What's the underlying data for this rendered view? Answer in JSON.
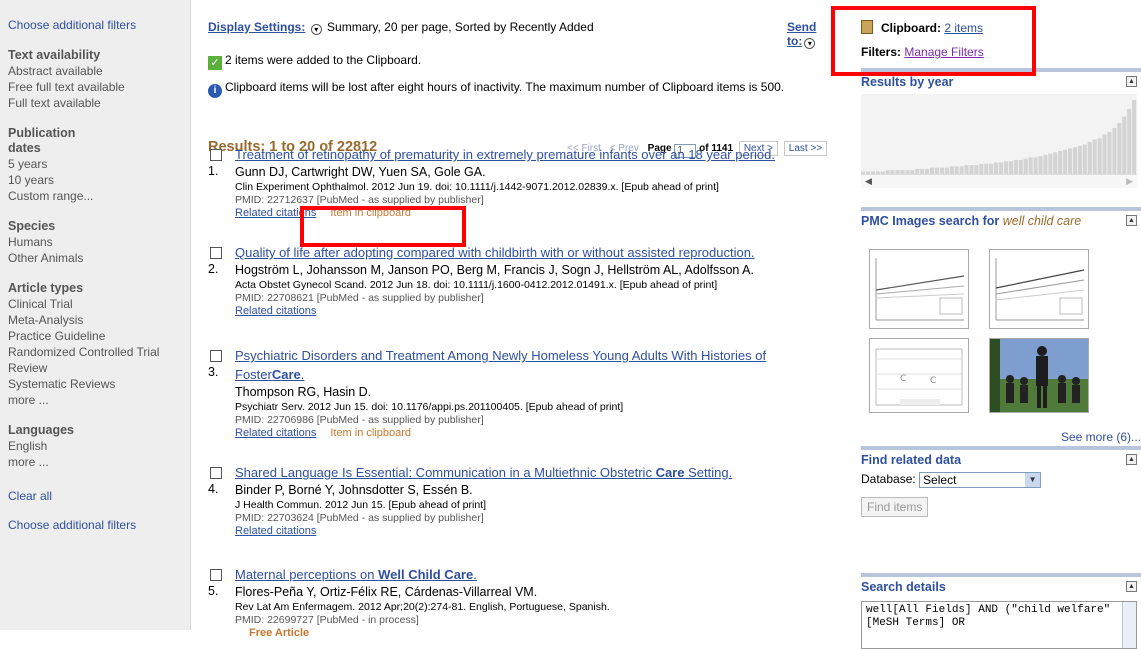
{
  "left": {
    "choose_filters_top": "Choose additional filters",
    "groups": [
      {
        "title": "Text availability",
        "items": [
          "Abstract available",
          "Free full text available",
          "Full text available"
        ]
      },
      {
        "title": "Publication dates",
        "items": [
          "5 years",
          "10 years",
          "Custom range..."
        ]
      },
      {
        "title": "Species",
        "items": [
          "Humans",
          "Other Animals"
        ]
      },
      {
        "title": "Article types",
        "items": [
          "Clinical Trial",
          "Meta-Analysis",
          "Practice Guideline",
          "Randomized Controlled Trial",
          "Review",
          "Systematic Reviews",
          "more ..."
        ]
      },
      {
        "title": "Languages",
        "items": [
          "English",
          "more ..."
        ]
      }
    ],
    "clear_all": "Clear all",
    "choose_filters_bottom": "Choose additional filters"
  },
  "display": {
    "label": "Display Settings:",
    "value": "Summary, 20 per page, Sorted by Recently Added",
    "send_to": "Send to:"
  },
  "messages": {
    "added": "2 items were added to the Clipboard.",
    "warning": "Clipboard items will be lost after eight hours of inactivity. The maximum number of Clipboard items is 500."
  },
  "results": {
    "count_text": "Results: 1 to 20 of 22812",
    "pager": {
      "first": "<< First",
      "prev": "< Prev",
      "page_label": "Page",
      "page_value": "1",
      "of_text": "of 1141",
      "next": "Next >",
      "last": "Last >>"
    },
    "items": [
      {
        "num": "1.",
        "title": "Treatment of retinopathy of prematurity in extremely premature infants over an 18 year period.",
        "authors": "Gunn DJ, Cartwright DW, Yuen SA, Gole GA.",
        "citation": "Clin Experiment Ophthalmol. 2012 Jun 19. doi: 10.1111/j.1442-9071.2012.02839.x. [Epub ahead of print]",
        "pmid": "PMID: 22712637 [PubMed - as supplied by publisher]",
        "related": "Related citations",
        "clip": "Item in clipboard",
        "free": ""
      },
      {
        "num": "2.",
        "title": "Quality of life after adopting compared with childbirth with or without assisted reproduction.",
        "authors": "Hogström L, Johansson M, Janson PO, Berg M, Francis J, Sogn J, Hellström AL, Adolfsson A.",
        "citation": "Acta Obstet Gynecol Scand. 2012 Jun 18. doi: 10.1111/j.1600-0412.2012.01491.x. [Epub ahead of print]",
        "pmid": "PMID: 22708621 [PubMed - as supplied by publisher]",
        "related": "Related citations",
        "clip": "",
        "free": ""
      },
      {
        "num": "3.",
        "title_plain": "Psychiatric Disorders and Treatment Among Newly Homeless Young Adults With Histories of Foster",
        "title_bold": "Care",
        "title_end": ".",
        "authors": "Thompson RG, Hasin D.",
        "citation": "Psychiatr Serv. 2012 Jun 15. doi: 10.1176/appi.ps.201100405. [Epub ahead of print]",
        "pmid": "PMID: 22706986 [PubMed - as supplied by publisher]",
        "related": "Related citations",
        "clip": "Item in clipboard",
        "free": ""
      },
      {
        "num": "4.",
        "title_plain": "Shared Language Is Essential: Communication in a Multiethnic Obstetric ",
        "title_bold": "Care",
        "title_end": " Setting.",
        "authors": "Binder P, Borné Y, Johnsdotter S, Essén B.",
        "citation": "J Health Commun. 2012 Jun 15. [Epub ahead of print]",
        "pmid": "PMID: 22703624 [PubMed - as supplied by publisher]",
        "related": "Related citations",
        "clip": "",
        "free": ""
      },
      {
        "num": "5.",
        "title_plain": "Maternal perceptions on ",
        "title_bold": "Well Child Care",
        "title_end": ".",
        "authors": "Flores-Peña Y, Ortiz-Félix RE, Cárdenas-Villarreal VM.",
        "citation": "Rev Lat Am Enfermagem. 2012 Apr;20(2):274-81. English, Portuguese, Spanish.",
        "pmid": "PMID: 22699727 [PubMed - in process]",
        "related": "",
        "clip": "",
        "free": "Free Article"
      }
    ]
  },
  "right": {
    "clipboard_label": "Clipboard:",
    "clipboard_link": "2 items",
    "filters_label": "Filters:",
    "filters_link": "Manage Filters",
    "results_by_year": "Results by year",
    "year_counts": [
      2,
      2,
      2,
      2,
      2,
      3,
      3,
      3,
      3,
      3,
      3,
      4,
      4,
      4,
      5,
      5,
      5,
      5,
      6,
      6,
      6,
      7,
      7,
      7,
      8,
      8,
      8,
      9,
      9,
      10,
      10,
      11,
      11,
      12,
      13,
      13,
      14,
      15,
      16,
      17,
      18,
      19,
      20,
      21,
      22,
      23,
      25,
      27,
      28,
      31,
      33,
      36,
      40,
      45,
      51,
      58
    ],
    "pmc_title": "PMC Images search for ",
    "pmc_query": "well child care",
    "see_more": "See more (6)...",
    "find_related": "Find related data",
    "database_label": "Database:",
    "database_value": "Select",
    "find_items": "Find items",
    "search_details": "Search details",
    "details_text": "well[All Fields] AND (\"child welfare\"[MeSH Terms] OR"
  },
  "colors": {
    "link": "#2f4f9f",
    "accent_orange": "#c8772f",
    "highlight": "#ff0000",
    "results_brown": "#996a2c"
  }
}
